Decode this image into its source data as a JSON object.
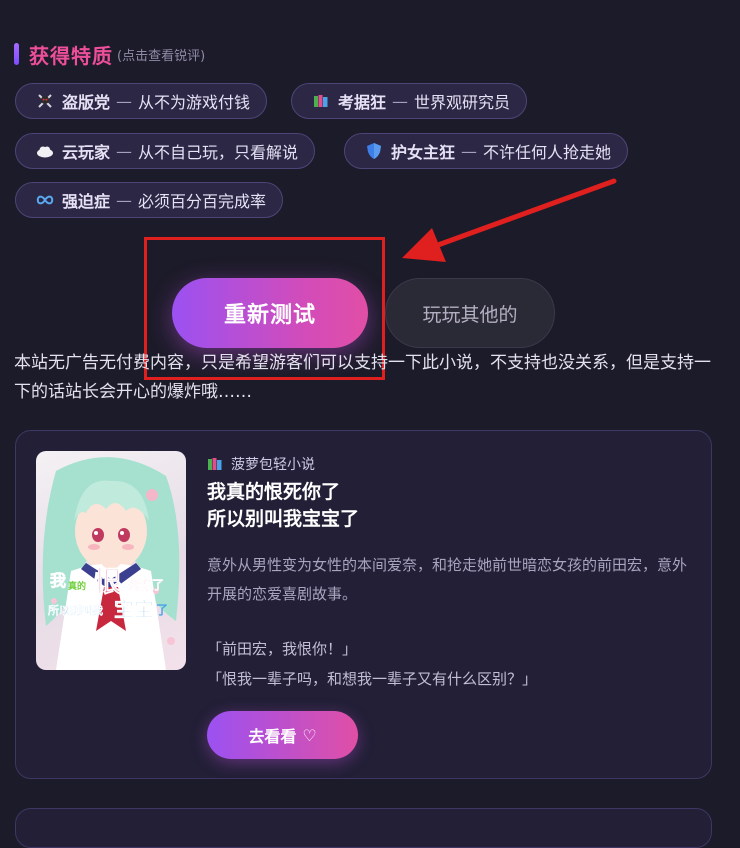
{
  "traits": {
    "title": "获得特质",
    "hint": "(点击查看锐评)",
    "tags": [
      {
        "icon": "skull-crossbones-icon",
        "name": "盗版党",
        "sep": "—",
        "desc": "从不为游戏付钱"
      },
      {
        "icon": "books-icon",
        "name": "考据狂",
        "sep": "—",
        "desc": "世界观研究员"
      },
      {
        "icon": "cloud-icon",
        "name": "云玩家",
        "sep": "—",
        "desc": "从不自己玩，只看解说"
      },
      {
        "icon": "shield-icon",
        "name": "护女主狂",
        "sep": "—",
        "desc": "不许任何人抢走她"
      },
      {
        "icon": "infinity-icon",
        "name": "强迫症",
        "sep": "—",
        "desc": "必须百分百完成率"
      }
    ]
  },
  "actions": {
    "retest": "重新测试",
    "other": "玩玩其他的"
  },
  "notice": "本站无广告无付费内容，只是希望游客们可以支持一下此小说，不支持也没关系，但是支持一下的话站长会开心的爆炸哦……",
  "book": {
    "source_icon": "books-icon",
    "source": "菠萝包轻小说",
    "title_line1": "我真的恨死你了",
    "title_line2": "所以别叫我宝宝了",
    "description": "意外从男性变为女性的本间爱奈，和抢走她前世暗恋女孩的前田宏，意外开展的恋爱喜剧故事。",
    "quote1": "「前田宏，我恨你！」",
    "quote2": "「恨我一辈子吗，和想我一辈子又有什么区别？」",
    "button": "去看看",
    "button_icon": "♡",
    "cover_text": {
      "p1": "我",
      "p2": "真的",
      "p3": "恨",
      "p4": "死你了",
      "p5": "所以别叫我",
      "p6": "宝宝",
      "p7": "了"
    }
  },
  "colors": {
    "accent_pink": "#ee4f9a",
    "accent_purple": "#9b51f2",
    "annotation_red": "#e01f1f",
    "background": "#1c1b29"
  }
}
